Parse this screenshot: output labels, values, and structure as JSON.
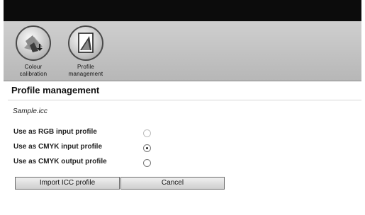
{
  "toolbar": {
    "tools": [
      {
        "label_line1": "Colour",
        "label_line2": "calibration",
        "icon": "colour-calibration-icon"
      },
      {
        "label_line1": "Profile",
        "label_line2": "management",
        "icon": "profile-management-icon"
      }
    ]
  },
  "main": {
    "title": "Profile management",
    "filename": "Sample.icc",
    "options": [
      {
        "label": "Use as RGB input profile",
        "state": "disabled"
      },
      {
        "label": "Use as CMYK input profile",
        "state": "checked"
      },
      {
        "label": "Use as CMYK output profile",
        "state": "unchecked"
      }
    ],
    "buttons": {
      "import_label": "Import ICC profile",
      "cancel_label": "Cancel"
    }
  },
  "colors": {
    "titlebar": "#0c0c0c",
    "toolbar": "#c2c2c2"
  }
}
